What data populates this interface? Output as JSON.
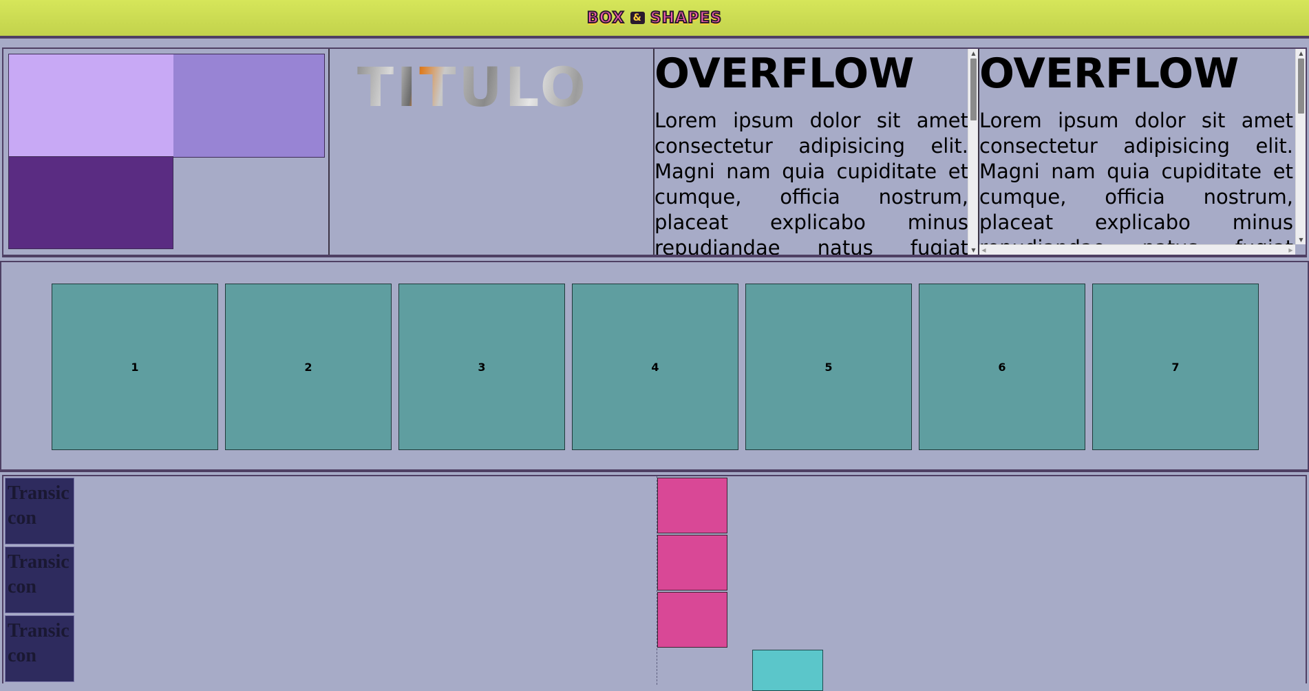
{
  "header": {
    "logo_left": "BOX",
    "logo_amp": "&",
    "logo_right": "SHAPES"
  },
  "section1": {
    "titulo": "TITULO",
    "overflow_title": "OVERFLOW",
    "overflow_text": "Lorem ipsum dolor sit amet consectetur adipisicing elit. Magni nam quia cupiditate et cumque, officia nostrum, placeat explicabo minus repudiandae natus fugiat voluptate sapiente velit."
  },
  "boxes": [
    "1",
    "2",
    "3",
    "4",
    "5",
    "6",
    "7"
  ],
  "transitions": [
    "Transic",
    "con"
  ],
  "colors": {
    "page_background": "#a7abc7",
    "header": "#cfe055",
    "light_purple": "#c8a9f5",
    "medium_purple": "#9884d4",
    "dark_purple": "#5a2c82",
    "box_teal": "#5f9ea0",
    "transition_navy": "#2e2b5e",
    "pink": "#d94896",
    "cyan": "#5bc6ca"
  }
}
